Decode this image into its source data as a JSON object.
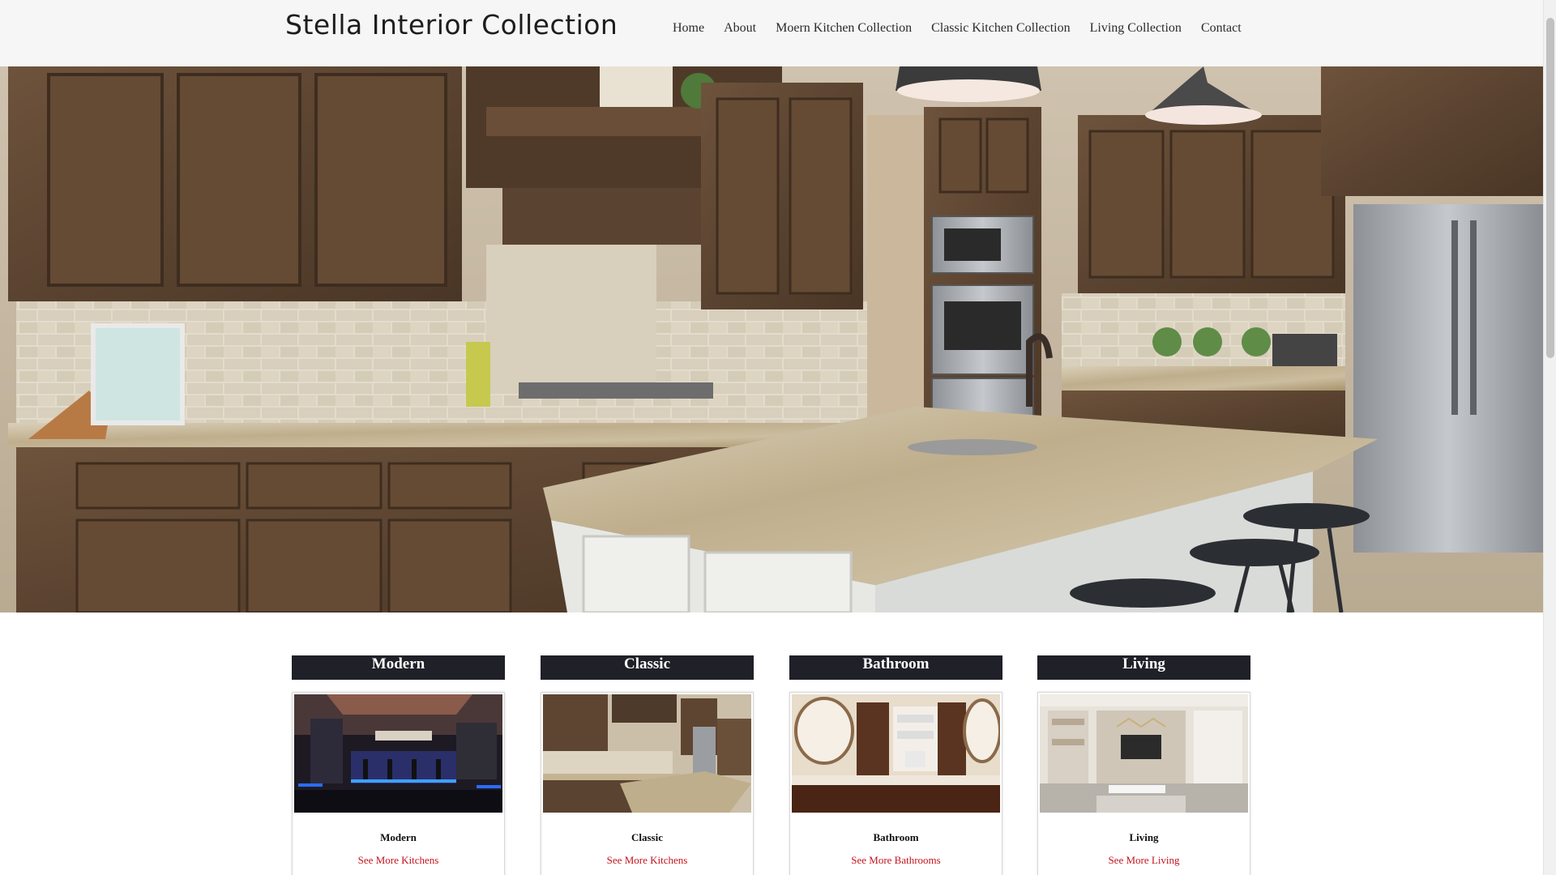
{
  "header": {
    "brand": "Stella Interior Collection",
    "nav": [
      {
        "label": "Home"
      },
      {
        "label": "About"
      },
      {
        "label": "Moern Kitchen Collection"
      },
      {
        "label": "Classic Kitchen Collection"
      },
      {
        "label": "Living Collection"
      },
      {
        "label": "Contact"
      }
    ]
  },
  "hero": {
    "image": "kitchen-hero-photo"
  },
  "cards": [
    {
      "title": "Modern",
      "name": "Modern",
      "link": "See More Kitchens",
      "image": "modern-kitchen-photo"
    },
    {
      "title": "Classic",
      "name": "Classic",
      "link": "See More Kitchens",
      "image": "classic-kitchen-photo"
    },
    {
      "title": "Bathroom",
      "name": "Bathroom",
      "link": "See More Bathrooms",
      "image": "bathroom-photo"
    },
    {
      "title": "Living",
      "name": "Living",
      "link": "See More Living",
      "image": "living-room-photo"
    }
  ],
  "colors": {
    "header_bg": "#f6f6f6",
    "card_title_bg": "#1f2028",
    "link": "#c3141d"
  }
}
